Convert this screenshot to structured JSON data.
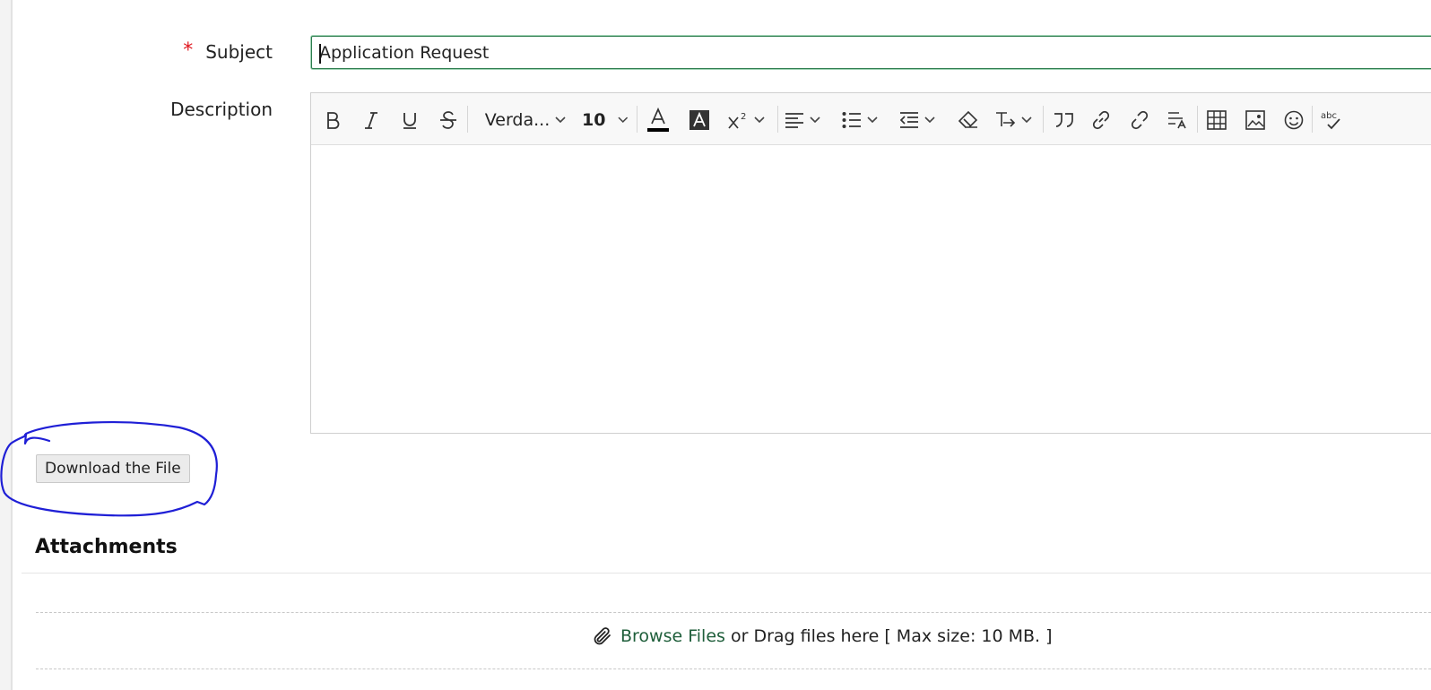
{
  "form": {
    "subject_required_mark": "*",
    "subject_label": "Subject",
    "subject_value": "Application Request",
    "description_label": "Description"
  },
  "editor_toolbar": {
    "buttons": [
      "bold-icon",
      "italic-icon",
      "underline-icon",
      "strikethrough-icon",
      "font-family",
      "font-size",
      "text-color-icon",
      "highlight-color-icon",
      "superscript-icon",
      "align-icon",
      "list-icon",
      "indent-icon",
      "clear-format-icon",
      "text-direction-icon",
      "blockquote-icon",
      "link-icon",
      "unlink-icon",
      "find-replace-icon",
      "table-icon",
      "image-icon",
      "emoji-icon",
      "spellcheck-icon"
    ],
    "font_family": "Verda...",
    "font_size": "10",
    "text_color": "#000000"
  },
  "actions": {
    "download_label": "Download the File"
  },
  "attachments": {
    "title": "Attachments",
    "browse_label": "Browse Files",
    "drag_text": "or Drag files here [ Max size: 10 MB. ]"
  },
  "colors": {
    "required": "#e0171f",
    "link": "#1e5e3a",
    "input_focus_border": "#2e7d4f",
    "annotation_ink": "#1f1fd6"
  }
}
